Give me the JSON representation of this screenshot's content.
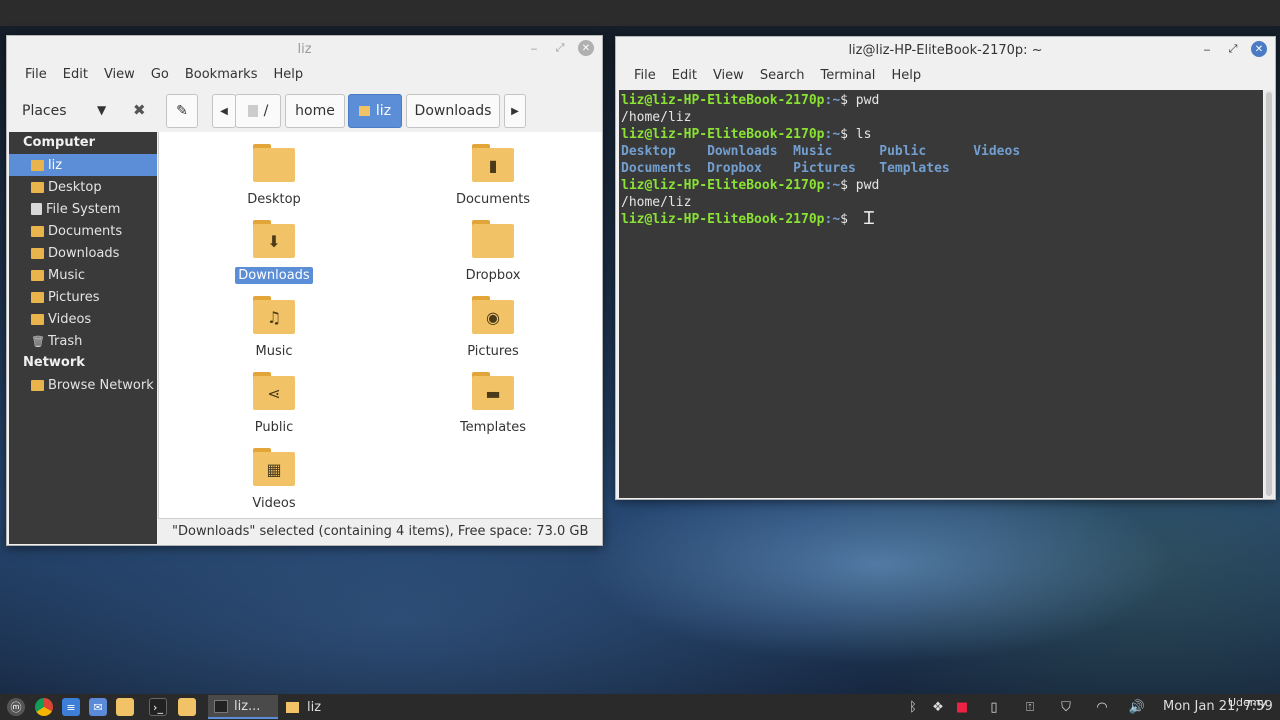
{
  "file_manager": {
    "title": "liz",
    "menu": [
      "File",
      "Edit",
      "View",
      "Go",
      "Bookmarks",
      "Help"
    ],
    "places_label": "Places",
    "path": {
      "root": "/",
      "segments": [
        "home",
        "liz",
        "Downloads"
      ]
    },
    "sidebar": {
      "computer_heading": "Computer",
      "computer_items": [
        {
          "label": "liz",
          "icon": "home-folder-icon",
          "selected": true
        },
        {
          "label": "Desktop",
          "icon": "folder-icon"
        },
        {
          "label": "File System",
          "icon": "drive-icon"
        },
        {
          "label": "Documents",
          "icon": "folder-documents-icon"
        },
        {
          "label": "Downloads",
          "icon": "folder-download-icon"
        },
        {
          "label": "Music",
          "icon": "folder-music-icon"
        },
        {
          "label": "Pictures",
          "icon": "folder-pictures-icon"
        },
        {
          "label": "Videos",
          "icon": "folder-videos-icon"
        },
        {
          "label": "Trash",
          "icon": "trash-icon"
        }
      ],
      "network_heading": "Network",
      "network_items": [
        {
          "label": "Browse Network",
          "icon": "network-folder-icon"
        }
      ]
    },
    "items": [
      {
        "label": "Desktop",
        "icon": "folder-icon"
      },
      {
        "label": "Documents",
        "icon": "folder-documents-icon"
      },
      {
        "label": "Downloads",
        "icon": "folder-download-icon",
        "selected": true
      },
      {
        "label": "Dropbox",
        "icon": "folder-icon"
      },
      {
        "label": "Music",
        "icon": "folder-music-icon"
      },
      {
        "label": "Pictures",
        "icon": "folder-pictures-icon"
      },
      {
        "label": "Public",
        "icon": "folder-share-icon"
      },
      {
        "label": "Templates",
        "icon": "folder-templates-icon"
      },
      {
        "label": "Videos",
        "icon": "folder-videos-icon"
      }
    ],
    "status": "\"Downloads\" selected (containing 4 items), Free space: 73.0 GB"
  },
  "terminal": {
    "title": "liz@liz-HP-EliteBook-2170p: ~",
    "menu": [
      "File",
      "Edit",
      "View",
      "Search",
      "Terminal",
      "Help"
    ],
    "prompt": "liz@liz-HP-EliteBook-2170p",
    "prompt_path": ":~",
    "prompt_suffix": "$",
    "lines": [
      {
        "type": "cmd",
        "text": " pwd"
      },
      {
        "type": "out",
        "text": "/home/liz"
      },
      {
        "type": "cmd",
        "text": " ls"
      },
      {
        "type": "dirs",
        "text": "Desktop    Downloads  Music      Public      Videos"
      },
      {
        "type": "dirs",
        "text": "Documents  Dropbox    Pictures   Templates"
      },
      {
        "type": "cmd",
        "text": " pwd"
      },
      {
        "type": "out",
        "text": "/home/liz"
      },
      {
        "type": "cmd",
        "text": " "
      }
    ]
  },
  "taskbar": {
    "windows": [
      {
        "label": "liz...",
        "icon": "terminal-icon",
        "active": true
      },
      {
        "label": "liz",
        "icon": "folder-icon",
        "active": false
      }
    ],
    "clock": "Mon Jan 21, 7:59",
    "watermark": "Udemy"
  }
}
